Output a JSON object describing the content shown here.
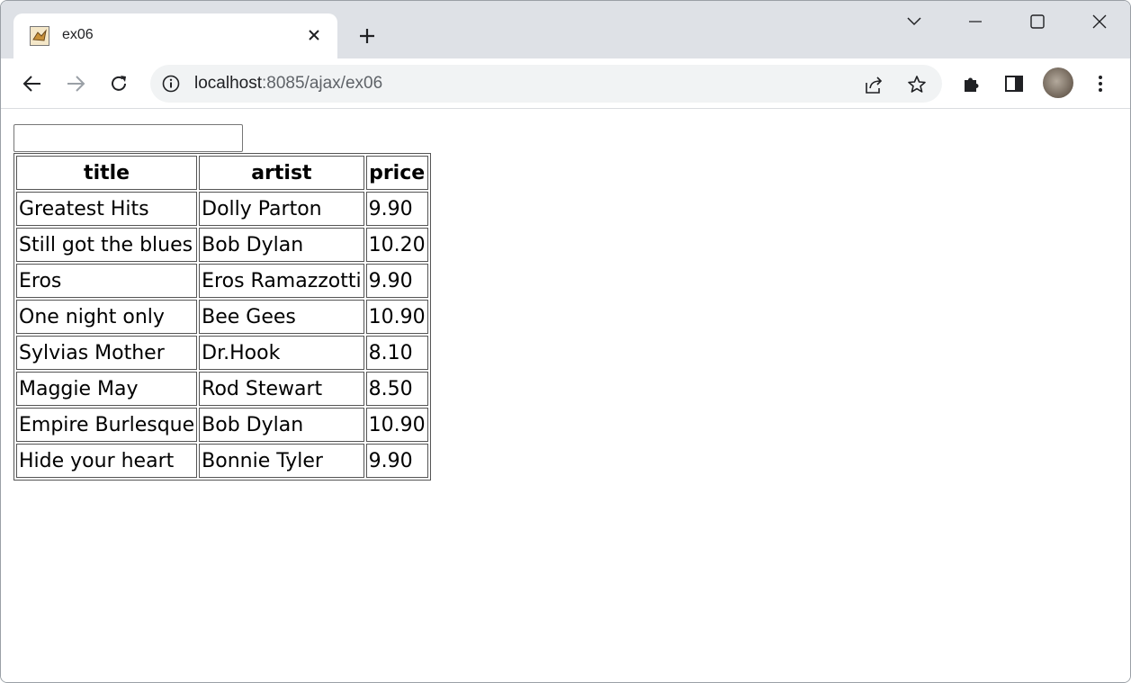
{
  "browser": {
    "tab_title": "ex06",
    "url_host": "localhost",
    "url_rest": ":8085/ajax/ex06"
  },
  "page": {
    "search_value": "",
    "table": {
      "headers": [
        "title",
        "artist",
        "price"
      ],
      "rows": [
        [
          "Greatest Hits",
          "Dolly Parton",
          "9.90"
        ],
        [
          "Still got the blues",
          "Bob Dylan",
          "10.20"
        ],
        [
          "Eros",
          "Eros Ramazzotti",
          "9.90"
        ],
        [
          "One night only",
          "Bee Gees",
          "10.90"
        ],
        [
          "Sylvias Mother",
          "Dr.Hook",
          "8.10"
        ],
        [
          "Maggie May",
          "Rod Stewart",
          "8.50"
        ],
        [
          "Empire Burlesque",
          "Bob Dylan",
          "10.90"
        ],
        [
          "Hide your heart",
          "Bonnie Tyler",
          "9.90"
        ]
      ]
    }
  }
}
